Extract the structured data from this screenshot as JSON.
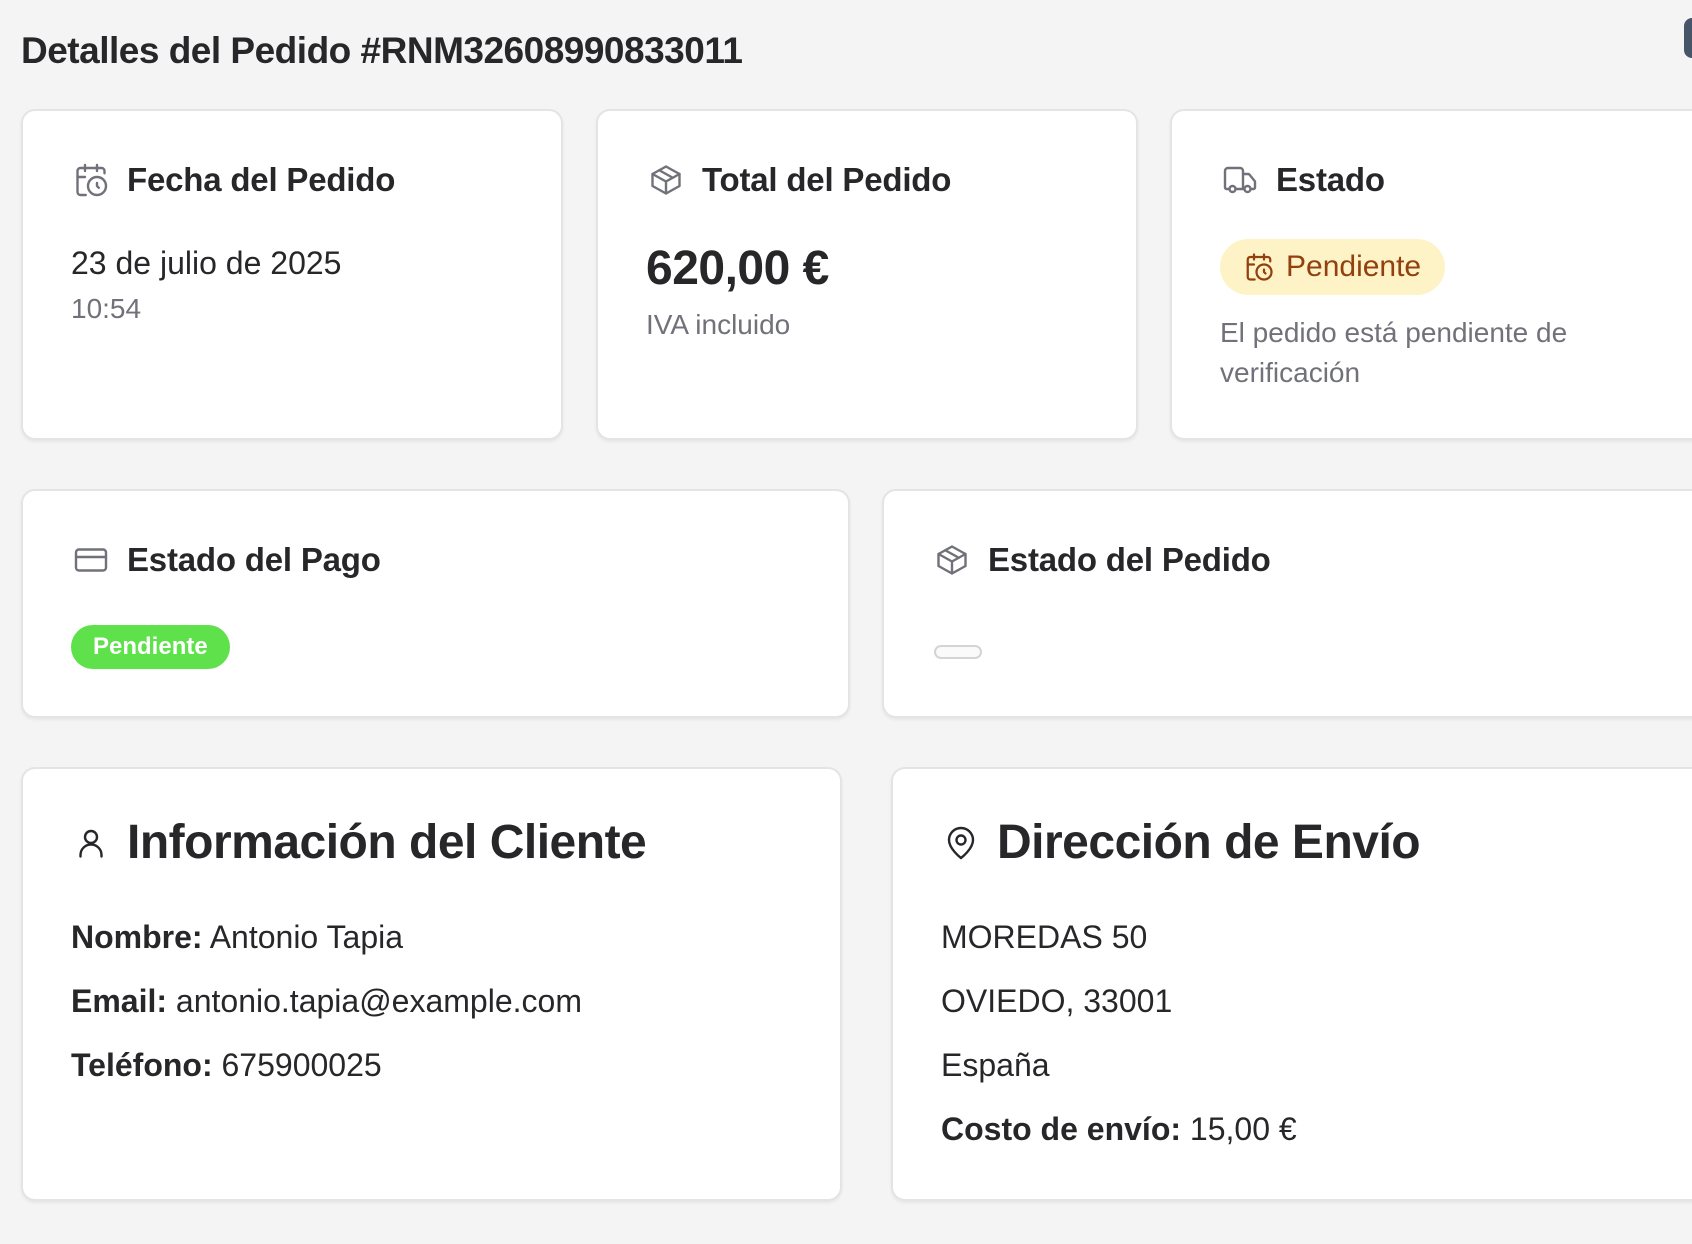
{
  "page": {
    "title": "Detalles del Pedido #RNM32608990833011"
  },
  "order_date": {
    "label": "Fecha del Pedido",
    "date": "23 de julio de 2025",
    "time": "10:54"
  },
  "order_total": {
    "label": "Total del Pedido",
    "amount": "620,00 €",
    "note": "IVA incluido"
  },
  "status": {
    "label": "Estado",
    "badge": "Pendiente",
    "description": "El pedido está pendiente de verificación",
    "badge_bg": "#fef3c7",
    "badge_color": "#92400e"
  },
  "payment_status": {
    "label": "Estado del Pago",
    "badge": "Pendiente",
    "badge_bg": "#5ee14a"
  },
  "order_status": {
    "label": "Estado del Pedido"
  },
  "customer": {
    "title": "Información del Cliente",
    "name_label": "Nombre:",
    "name": "Antonio Tapia",
    "email_label": "Email:",
    "email": "antonio.tapia@example.com",
    "phone_label": "Teléfono:",
    "phone": "675900025"
  },
  "shipping": {
    "title": "Dirección de Envío",
    "line1": "MOREDAS 50",
    "line2": "OVIEDO, 33001",
    "country": "España",
    "cost_label": "Costo de envío:",
    "cost": "15,00 €"
  },
  "icons": {
    "order_date": "calendar-clock-icon",
    "order_total": "package-icon",
    "status": "truck-icon",
    "status_badge": "calendar-clock-icon",
    "payment": "credit-card-icon",
    "order_status": "package-icon",
    "customer": "user-icon",
    "shipping": "map-pin-icon"
  }
}
